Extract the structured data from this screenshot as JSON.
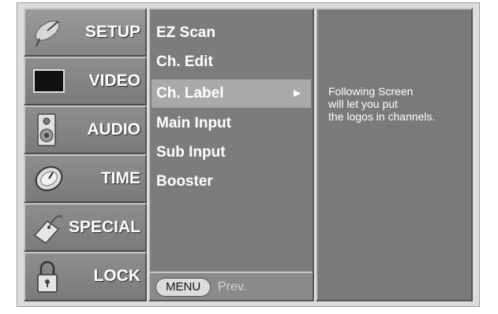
{
  "tabs": [
    {
      "id": "setup",
      "label": "SETUP",
      "icon": "satellite-dish-icon",
      "active": true
    },
    {
      "id": "video",
      "label": "VIDEO",
      "icon": "tv-screen-icon",
      "active": false
    },
    {
      "id": "audio",
      "label": "AUDIO",
      "icon": "speaker-icon",
      "active": false
    },
    {
      "id": "time",
      "label": "TIME",
      "icon": "clock-icon",
      "active": false
    },
    {
      "id": "special",
      "label": "SPECIAL",
      "icon": "tag-icon",
      "active": false
    },
    {
      "id": "lock",
      "label": "LOCK",
      "icon": "padlock-icon",
      "active": false
    }
  ],
  "submenu": {
    "items": [
      {
        "label": "EZ Scan",
        "selected": false
      },
      {
        "label": "Ch. Edit",
        "selected": false
      },
      {
        "label": "Ch. Label",
        "selected": true,
        "arrow": "►"
      },
      {
        "label": "Main Input",
        "selected": false
      },
      {
        "label": "Sub Input",
        "selected": false
      },
      {
        "label": "Booster",
        "selected": false
      }
    ],
    "footer": {
      "menu_button": "MENU",
      "prev_label": "Prev."
    }
  },
  "info": {
    "lines": [
      "Following Screen",
      "will let you put",
      "the logos in channels."
    ]
  },
  "colors": {
    "panel": "#7c7c7c",
    "highlight": "#a9a9a9",
    "text": "#ffffff"
  }
}
